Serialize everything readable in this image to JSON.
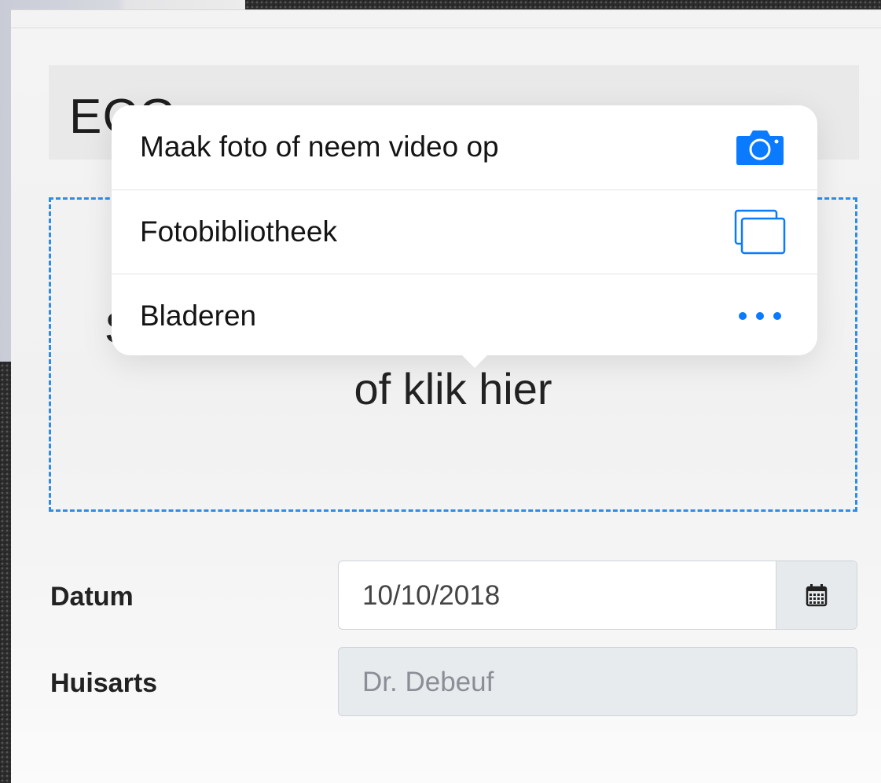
{
  "section": {
    "title": "ECG"
  },
  "dropzone": {
    "line1": "S",
    "line2": "of klik hier"
  },
  "form": {
    "date_label": "Datum",
    "date_value": "10/10/2018",
    "doctor_label": "Huisarts",
    "doctor_placeholder": "Dr. Debeuf"
  },
  "popover": {
    "items": [
      {
        "label": "Maak foto of neem video op",
        "icon": "camera-icon"
      },
      {
        "label": "Fotobibliotheek",
        "icon": "photo-library-icon"
      },
      {
        "label": "Bladeren",
        "icon": "more-dots-icon"
      }
    ]
  },
  "colors": {
    "accent": "#0a7aff",
    "dashed_border": "#2f8ce6"
  }
}
